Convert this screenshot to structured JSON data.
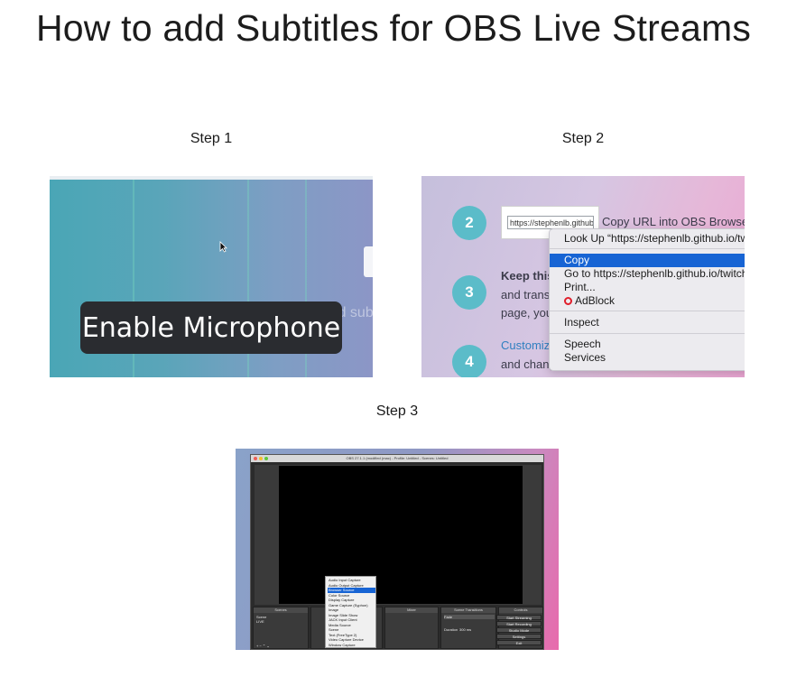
{
  "page": {
    "title": "How to add Subtitles for OBS Live Streams"
  },
  "steps": [
    {
      "label": "Step 1"
    },
    {
      "label": "Step 2"
    },
    {
      "label": "Step 3"
    }
  ],
  "step1": {
    "button_label": "Enable Microphone",
    "faint_text": "Add sub",
    "colors": {
      "bg_start": "#4aa6b6",
      "bg_end": "#8c96c6",
      "button_bg": "#2a2c30"
    }
  },
  "step2": {
    "circles": [
      "2",
      "3",
      "4"
    ],
    "url_field": "https://stephenlb.github.io",
    "copy_instruction": "Copy URL into OBS Browse",
    "keep_heading": "Keep this",
    "body_line1": "and transl",
    "body_line2": "page, you",
    "customize_link": "Customiz",
    "body_line3": "and chang",
    "context_menu": {
      "lookup": "Look Up “https://stephenlb.github.io/twi",
      "copy": "Copy",
      "goto": "Go to https://stephenlb.github.io/twitch-",
      "print": "Print...",
      "adblock": "AdBlock",
      "inspect": "Inspect",
      "speech": "Speech",
      "services": "Services"
    },
    "colors": {
      "circle": "#5bbcc9",
      "highlight": "#1764d4",
      "link": "#2f7fc0"
    }
  },
  "step3": {
    "window_title": "OBS 27.1.1 (modified (mac) - Profile: Untitled - Scenes: Untitled",
    "docks": {
      "scenes": "Scenes",
      "mixer": "Mixer",
      "transitions": "Scene Transitions",
      "controls": "Controls"
    },
    "scene_items": [
      "Scene",
      "LIVE"
    ],
    "transition": {
      "type": "Fade",
      "duration_label": "Duration",
      "duration_value": "300 ms"
    },
    "controls": [
      "Start Streaming",
      "Start Recording",
      "Studio Mode",
      "Settings",
      "Exit"
    ],
    "source_menu": [
      "Audio Input Capture",
      "Audio Output Capture",
      "Browser Source",
      "Color Source",
      "Display Capture",
      "Game Capture (Syphon)",
      "Image",
      "Image Slide Show",
      "JACK Input Client",
      "Media Source",
      "Scene",
      "Text (FreeType 2)",
      "Video Capture Device",
      "Window Capture"
    ],
    "selected_source": "Browser Source"
  }
}
